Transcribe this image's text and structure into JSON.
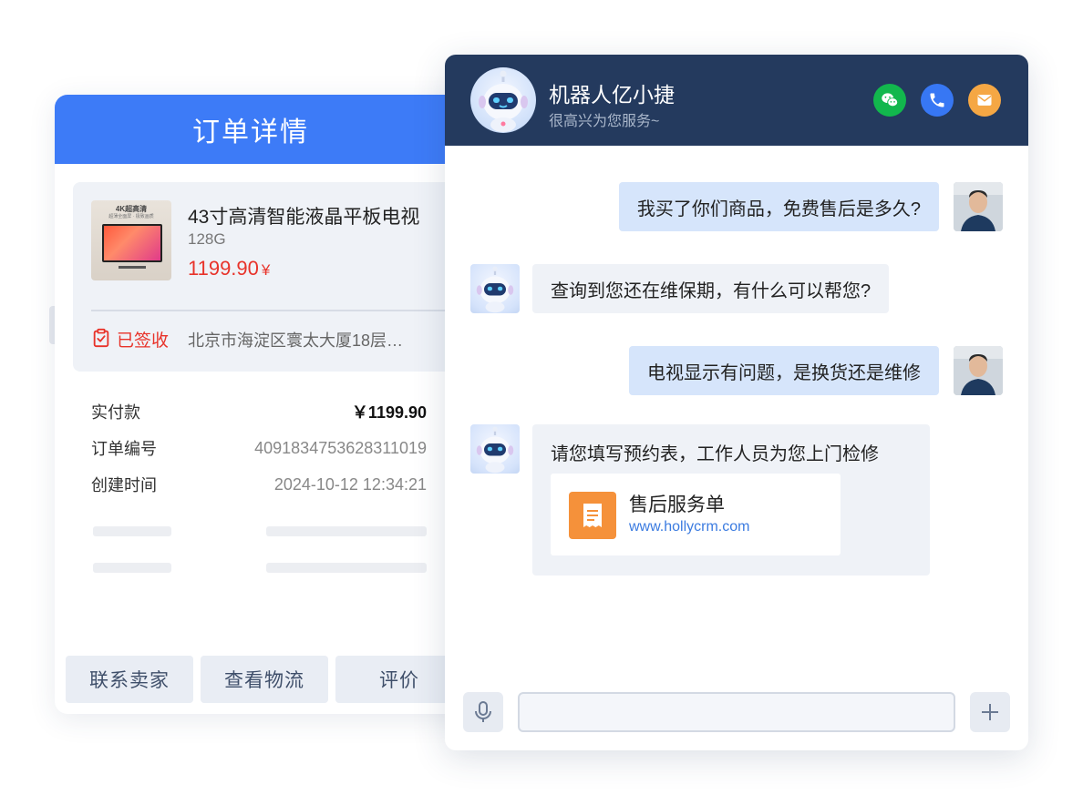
{
  "order": {
    "header_title": "订单详情",
    "product": {
      "thumb_label": "4K超高清",
      "thumb_sub": "超薄全面屏 · 极致画质",
      "name": "43寸高清智能液晶平板电视",
      "spec": "128G",
      "price": "1199.90",
      "currency": "¥"
    },
    "status_label": "已签收",
    "address": "北京市海淀区寰太大厦18层…",
    "info_rows": [
      {
        "label": "实付款",
        "value": "￥1199.90"
      },
      {
        "label": "订单编号",
        "value": "4091834753628311019"
      },
      {
        "label": "创建时间",
        "value": "2024-10-12 12:34:21"
      }
    ],
    "actions": [
      "联系卖家",
      "查看物流",
      "评价"
    ]
  },
  "chat": {
    "bot_name": "机器人亿小捷",
    "bot_tagline": "很高兴为您服务~",
    "header_icons": [
      "wechat-icon",
      "phone-icon",
      "mail-icon"
    ],
    "messages": [
      {
        "from": "user",
        "text": "我买了你们商品，免费售后是多久?"
      },
      {
        "from": "bot",
        "text": "查询到您还在维保期，有什么可以帮您?"
      },
      {
        "from": "user",
        "text": "电视显示有问题，是换货还是维修"
      },
      {
        "from": "bot",
        "text": "请您填写预约表，工作人员为您上门检修"
      }
    ],
    "service_card": {
      "title": "售后服务单",
      "url": "www.hollycrm.com"
    },
    "input_placeholder": ""
  },
  "colors": {
    "order_header": "#3d7bf7",
    "chat_header": "#243a5e",
    "price_red": "#e8332a",
    "user_bubble": "#d6e5fb",
    "bot_bubble": "#eff2f7",
    "wechat_green": "#12b74d",
    "phone_blue": "#3777f4",
    "mail_orange": "#f5a744",
    "card_icon_orange": "#f5913a"
  }
}
